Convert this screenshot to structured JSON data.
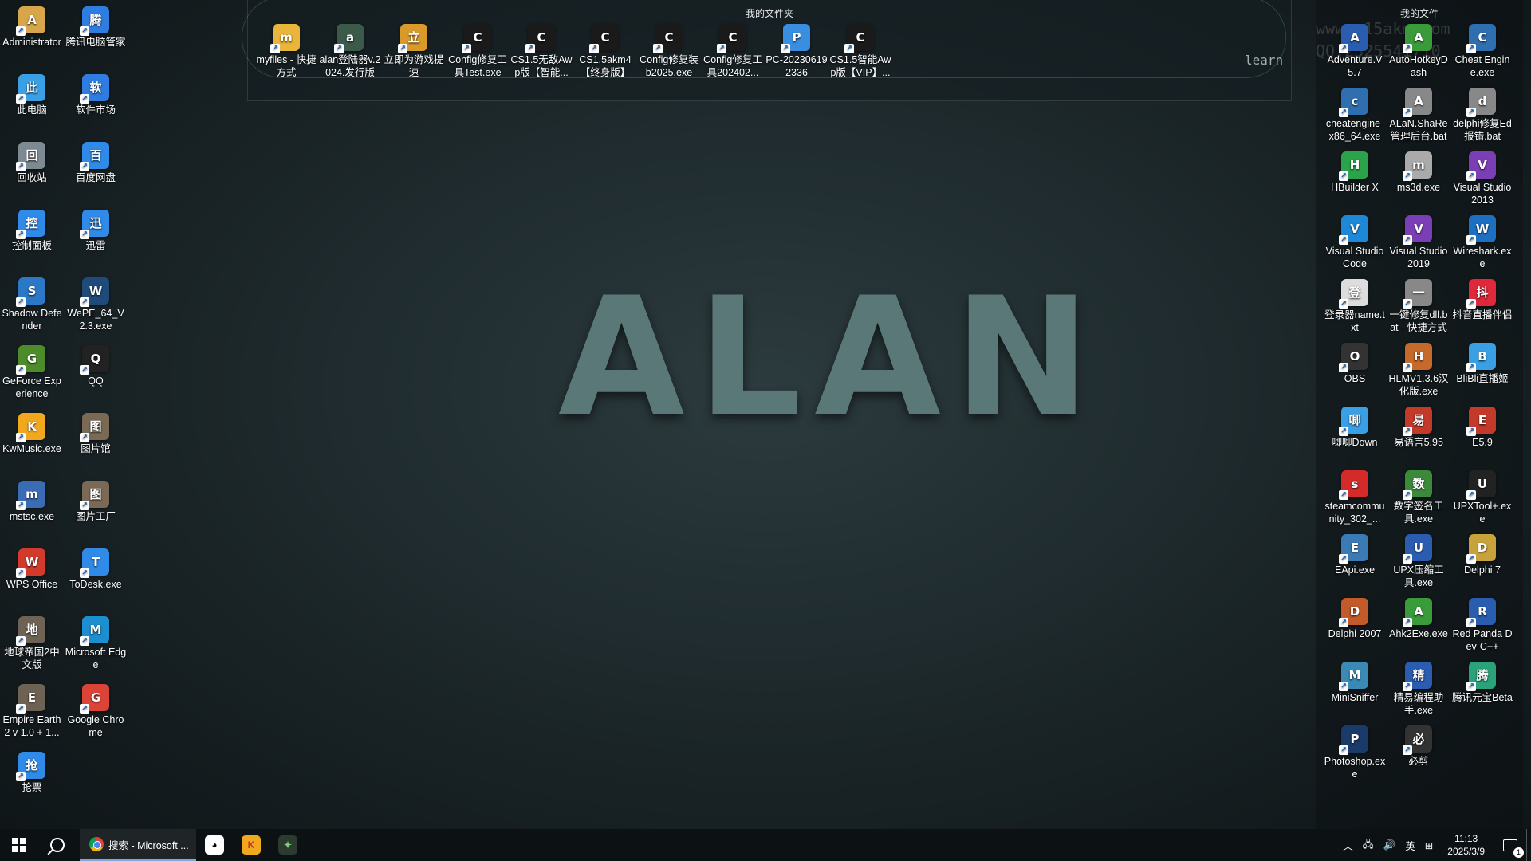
{
  "wallpaper_text": "ALAN",
  "fence": {
    "title": "我的文件夹",
    "extra_text": "learn"
  },
  "right_panel": {
    "title": "我的文件",
    "watermark_line1": "www.s15akm.com",
    "watermark_line2": "QQ:2325541710"
  },
  "left_icons": [
    {
      "label": "Administrator",
      "icon": "user-folder-icon",
      "color": "#d8a64a"
    },
    {
      "label": "腾讯电脑管家",
      "icon": "tencent-pc-manager-icon",
      "color": "#2f7de1"
    },
    {
      "label": "此电脑",
      "icon": "computer-icon",
      "color": "#3aa0e6"
    },
    {
      "label": "软件市场",
      "icon": "software-market-icon",
      "color": "#2f7de1"
    },
    {
      "label": "回收站",
      "icon": "recycle-bin-icon",
      "color": "#7e8a92"
    },
    {
      "label": "百度网盘",
      "icon": "baidu-netdisk-icon",
      "color": "#2f8ae8"
    },
    {
      "label": "控制面板",
      "icon": "control-panel-icon",
      "color": "#2f8ae8"
    },
    {
      "label": "迅雷",
      "icon": "xunlei-icon",
      "color": "#2f8ae8"
    },
    {
      "label": "Shadow Defender",
      "icon": "shadow-defender-icon",
      "color": "#2b78c7"
    },
    {
      "label": "WePE_64_V2.3.exe",
      "icon": "wepe-icon",
      "color": "#1f4a7a"
    },
    {
      "label": "GeForce Experience",
      "icon": "geforce-icon",
      "color": "#4c8c2a"
    },
    {
      "label": "QQ",
      "icon": "qq-penguin-icon",
      "color": "#222"
    },
    {
      "label": "KwMusic.exe",
      "icon": "kuwo-music-icon",
      "color": "#f2a81e"
    },
    {
      "label": "图片馆",
      "icon": "image-gallery-icon",
      "color": "#7a6a55"
    },
    {
      "label": "mstsc.exe",
      "icon": "remote-desktop-icon",
      "color": "#3a6bb5"
    },
    {
      "label": "图片工厂",
      "icon": "image-factory-icon",
      "color": "#7a6a55"
    },
    {
      "label": "WPS Office",
      "icon": "wps-office-icon",
      "color": "#d23b2b"
    },
    {
      "label": "ToDesk.exe",
      "icon": "todesk-icon",
      "color": "#2f8ae8"
    },
    {
      "label": "地球帝国2中文版",
      "icon": "empire-earth-icon",
      "color": "#6d6254"
    },
    {
      "label": "Microsoft Edge",
      "icon": "edge-icon",
      "color": "#1c8fd1"
    },
    {
      "label": "Empire Earth 2 v 1.0 + 1...",
      "icon": "empire-earth-icon",
      "color": "#6d6254"
    },
    {
      "label": "Google Chrome",
      "icon": "chrome-icon",
      "color": "#db4437"
    },
    {
      "label": "抢票",
      "icon": "ticket-icon",
      "color": "#2f8ae8"
    }
  ],
  "fence_icons": [
    {
      "label": "myfiles - 快捷方式",
      "icon": "folder-star-icon",
      "color": "#e9b53a"
    },
    {
      "label": "alan登陆器v.2024.发行版",
      "icon": "alan-launcher-icon",
      "color": "#3b5a4a"
    },
    {
      "label": "立即为游戏提速",
      "icon": "game-boost-icon",
      "color": "#d99a2b"
    },
    {
      "label": "Config修复工具Test.exe",
      "icon": "alan-tool-icon",
      "color": "#1a1a1a"
    },
    {
      "label": "CS1.5无敌Awp版【智能...",
      "icon": "alan-tool-icon",
      "color": "#1a1a1a"
    },
    {
      "label": "CS1.5akm4【终身版】",
      "icon": "akm-tool-icon",
      "color": "#1a1a1a"
    },
    {
      "label": "Config修复装b2025.exe",
      "icon": "alan-tool-icon",
      "color": "#1a1a1a"
    },
    {
      "label": "Config修复工具202402...",
      "icon": "alan-tool-icon",
      "color": "#1a1a1a"
    },
    {
      "label": "PC-202306192336",
      "icon": "pc-computer-icon",
      "color": "#3a8ee0"
    },
    {
      "label": "CS1.5智能Awp版【VIP】...",
      "icon": "alan-tool-icon",
      "color": "#1a1a1a"
    }
  ],
  "right_icons": [
    {
      "label": "Adventure.V5.7",
      "icon": "adventure-icon",
      "color": "#2a5db0"
    },
    {
      "label": "AutoHotkeyDash",
      "icon": "autohotkey-icon",
      "color": "#3a9b3a"
    },
    {
      "label": "Cheat Engine.exe",
      "icon": "cheat-engine-icon",
      "color": "#2f6fb0"
    },
    {
      "label": "cheatengine-x86_64.exe",
      "icon": "cheat-engine-icon",
      "color": "#2f6fb0"
    },
    {
      "label": "ALaN.ShaRe管理后台.bat",
      "icon": "bat-file-icon",
      "color": "#888"
    },
    {
      "label": "delphi修复Ed报错.bat",
      "icon": "bat-file-icon",
      "color": "#888"
    },
    {
      "label": "HBuilder X",
      "icon": "hbuilder-icon",
      "color": "#2aa34a"
    },
    {
      "label": "ms3d.exe",
      "icon": "ms3d-icon",
      "color": "#aaa"
    },
    {
      "label": "Visual Studio 2013",
      "icon": "visual-studio-icon",
      "color": "#7b3fb5"
    },
    {
      "label": "Visual Studio Code",
      "icon": "vscode-icon",
      "color": "#1e88d8"
    },
    {
      "label": "Visual Studio 2019",
      "icon": "visual-studio-icon",
      "color": "#7b3fb5"
    },
    {
      "label": "Wireshark.exe",
      "icon": "wireshark-icon",
      "color": "#1c6fc1"
    },
    {
      "label": "登录器name.txt",
      "icon": "text-file-icon",
      "color": "#ddd"
    },
    {
      "label": "一键修复dll.bat - 快捷方式",
      "icon": "bat-file-icon",
      "color": "#888"
    },
    {
      "label": "抖音直播伴侣",
      "icon": "douyin-live-icon",
      "color": "#e0283a"
    },
    {
      "label": "OBS",
      "icon": "obs-icon",
      "color": "#333"
    },
    {
      "label": "HLMV1.3.6汉化版.exe",
      "icon": "hlmv-icon",
      "color": "#c56a2a"
    },
    {
      "label": "BliBli直播姬",
      "icon": "bilibili-live-icon",
      "color": "#3aa0e6"
    },
    {
      "label": "唧唧Down",
      "icon": "jijidown-icon",
      "color": "#3aa0e6"
    },
    {
      "label": "易语言5.95",
      "icon": "eyuyan-icon",
      "color": "#c43a2a"
    },
    {
      "label": "E5.9",
      "icon": "eyuyan-icon",
      "color": "#c43a2a"
    },
    {
      "label": "steamcommunity_302_...",
      "icon": "steamcommunity-icon",
      "color": "#d42a2a"
    },
    {
      "label": "数字签名工具.exe",
      "icon": "digital-sign-icon",
      "color": "#3a8a3a"
    },
    {
      "label": "UPXTool+.exe",
      "icon": "upx-icon",
      "color": "#222"
    },
    {
      "label": "EApi.exe",
      "icon": "eapi-icon",
      "color": "#3a7ab5"
    },
    {
      "label": "UPX压缩工具.exe",
      "icon": "upx-compress-icon",
      "color": "#2a5db0"
    },
    {
      "label": "Delphi 7",
      "icon": "delphi-icon",
      "color": "#c8a23a"
    },
    {
      "label": "Delphi 2007",
      "icon": "delphi-icon",
      "color": "#c25a2a"
    },
    {
      "label": "Ahk2Exe.exe",
      "icon": "autohotkey-icon",
      "color": "#3a9b3a"
    },
    {
      "label": "Red Panda Dev-C++",
      "icon": "devcpp-icon",
      "color": "#2a5db0"
    },
    {
      "label": "MiniSniffer",
      "icon": "minisniffer-icon",
      "color": "#3a8ab5"
    },
    {
      "label": "精易编程助手.exe",
      "icon": "jingyi-icon",
      "color": "#2a5db0"
    },
    {
      "label": "腾讯元宝Beta",
      "icon": "yuanbao-icon",
      "color": "#2aa37a"
    },
    {
      "label": "Photoshop.exe",
      "icon": "photoshop-icon",
      "color": "#1a3a6a"
    },
    {
      "label": "必剪",
      "icon": "bijian-icon",
      "color": "#333"
    }
  ],
  "taskbar": {
    "chrome_title": "搜索 - Microsoft ...",
    "ime": "英",
    "time": "11:13",
    "date": "2025/3/9",
    "notification_count": "1"
  }
}
